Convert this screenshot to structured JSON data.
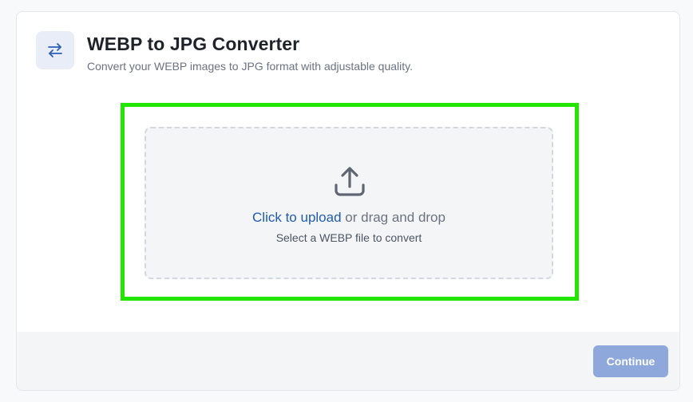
{
  "header": {
    "icon": "swap-arrows-icon",
    "title": "WEBP to JPG Converter",
    "subtitle": "Convert your WEBP images to JPG format with adjustable quality."
  },
  "dropzone": {
    "icon": "upload-icon",
    "link_text": "Click to upload",
    "rest_text": " or drag and drop",
    "hint": "Select a WEBP file to convert"
  },
  "footer": {
    "continue_label": "Continue",
    "continue_disabled": true
  },
  "colors": {
    "accent": "#1f5bb4",
    "button_disabled": "#8ea8dc",
    "highlight": "#22e600"
  }
}
